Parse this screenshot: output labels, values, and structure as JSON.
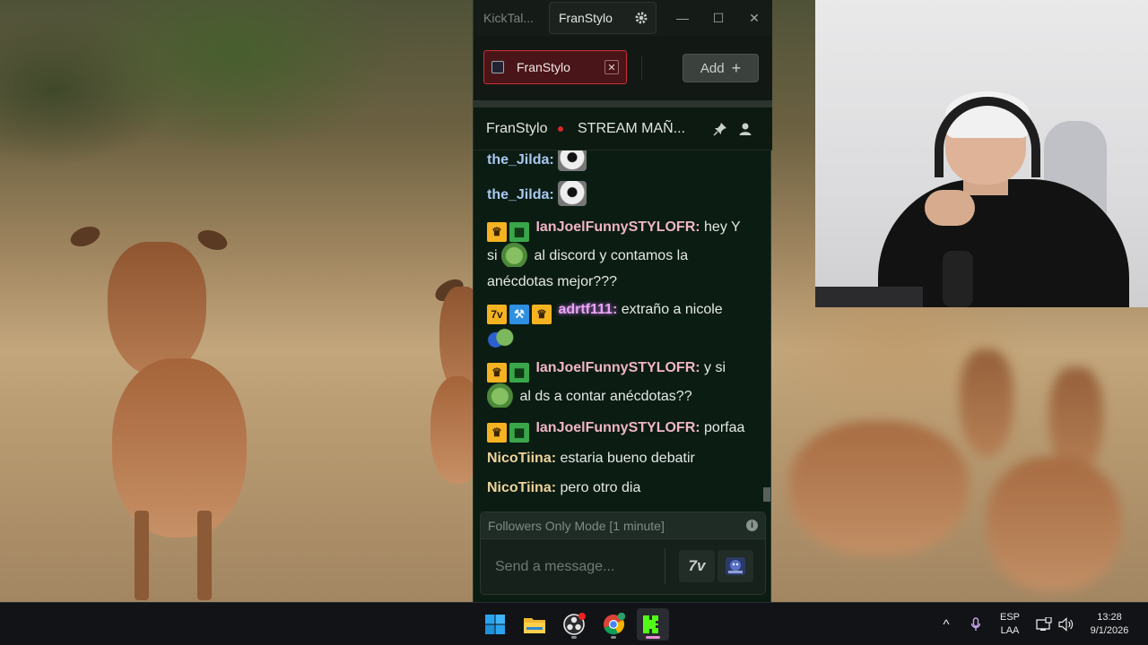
{
  "window": {
    "app_name": "KickTal...",
    "active_tab": "FranStylo",
    "minimize_symbol": "—",
    "maximize_symbol": "☐",
    "close_symbol": "✕"
  },
  "channel_tabs": {
    "tabs": [
      {
        "label": "FranStylo",
        "close_symbol": "✕"
      }
    ],
    "add_label": "Add",
    "add_symbol": "+"
  },
  "stream": {
    "channel": "FranStylo",
    "title": "STREAM MAÑ...",
    "live_color": "#d42a2a"
  },
  "chat": {
    "messages": [
      {
        "user": "the_Jilda:",
        "text": "",
        "emote": "cat-emote"
      },
      {
        "user": "the_Jilda:",
        "text": "",
        "emote": "cat-emote"
      },
      {
        "user": "IanJoelFunnySTYLOFR:",
        "text": "hey Y",
        "line2_pre": "si",
        "line2_post": "al discord y contamos la",
        "line3": "anécdotas mejor???"
      },
      {
        "user": "adrtf111:",
        "text": "extraño a nicole"
      },
      {
        "user": "IanJoelFunnySTYLOFR:",
        "text": "y si",
        "line2_post": "al ds a contar anécdotas??"
      },
      {
        "user": "IanJoelFunnySTYLOFR:",
        "text": "porfaa"
      },
      {
        "user": "NicoTiina:",
        "text": "estaria bueno debatir"
      },
      {
        "user": "NicoTiina:",
        "text": "pero otro dia"
      }
    ],
    "badges": {
      "crown": "♛",
      "sub": "▦",
      "seventv": "7v",
      "hammer": "⚒"
    }
  },
  "composer": {
    "followers_note": "Followers Only Mode [1 minute]",
    "info_symbol": "i",
    "placeholder": "Send a message...",
    "seventv_label": "7v"
  },
  "taskbar": {
    "language_top": "ESP",
    "language_bottom": "LAA",
    "time": "13:28",
    "date": "9/1/2026",
    "chevron": "^"
  },
  "colors": {
    "accent_red": "#c62f36",
    "kick_green": "#53fc18",
    "chat_bg": "#0b1c13"
  }
}
